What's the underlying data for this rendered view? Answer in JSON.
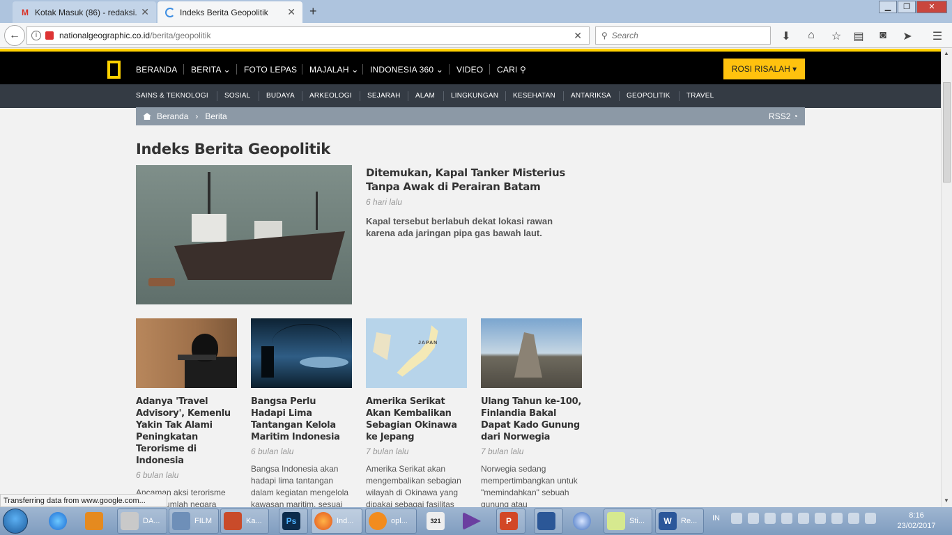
{
  "browser": {
    "tabs": [
      {
        "title": "Kotak Masuk (86) - redaksi....",
        "active": false,
        "icon": "gmail-icon"
      },
      {
        "title": "Indeks Berita Geopolitik",
        "active": true,
        "icon": "loading-icon"
      }
    ],
    "new_tab": "+",
    "url_host": "nationalgeographic.co.id",
    "url_path": "/berita/geopolitik",
    "search_placeholder": "Search",
    "status": "Transferring data from www.google.com..."
  },
  "site": {
    "brand_color": "#ffd100",
    "main_nav": [
      {
        "label": "BERANDA",
        "has_dropdown": false
      },
      {
        "label": "BERITA",
        "has_dropdown": true
      },
      {
        "label": "FOTO LEPAS",
        "has_dropdown": false
      },
      {
        "label": "MAJALAH",
        "has_dropdown": true
      },
      {
        "label": "INDONESIA 360",
        "has_dropdown": true
      },
      {
        "label": "VIDEO",
        "has_dropdown": false
      },
      {
        "label": "CARI",
        "has_dropdown": false
      }
    ],
    "user_label": "ROSI RISALAH",
    "sub_nav": [
      "SAINS & TEKNOLOGI",
      "SOSIAL",
      "BUDAYA",
      "ARKEOLOGI",
      "SEJARAH",
      "ALAM",
      "LINGKUNGAN",
      "KESEHATAN",
      "ANTARIKSA",
      "GEOPOLITIK",
      "TRAVEL"
    ],
    "breadcrumb": [
      "Beranda",
      "Berita"
    ],
    "rss_label": "RSS2"
  },
  "page": {
    "title": "Indeks Berita Geopolitik",
    "featured": {
      "title": "Ditemukan, Kapal Tanker Misterius Tanpa Awak di Perairan Batam",
      "time": "6 hari lalu",
      "excerpt": "Kapal tersebut berlabuh dekat lokasi rawan karena ada jaringan pipa gas bawah laut."
    },
    "cards": [
      {
        "title": "Adanya 'Travel Advisory', Kemenlu Yakin Tak Alami Peningkatan Terorisme di Indonesia",
        "time": "6 bulan lalu",
        "excerpt": "Ancaman aksi terorisme buat sejumlah negara"
      },
      {
        "title": "Bangsa Perlu Hadapi Lima Tantangan Kelola Maritim Indonesia",
        "time": "6 bulan lalu",
        "excerpt": "Bangsa Indonesia akan hadapi lima tantangan dalam kegiatan mengelola kawasan maritim, sesuai hukum"
      },
      {
        "title": "Amerika Serikat Akan Kembalikan Sebagian Okinawa ke Jepang",
        "time": "7 bulan lalu",
        "excerpt": "Amerika Serikat akan mengembalikan sebagian wilayah di Okinawa yang dipakai sebagai fasilitas"
      },
      {
        "title": "Ulang Tahun ke-100, Finlandia Bakal Dapat Kado Gunung dari Norwegia",
        "time": "7 bulan lalu",
        "excerpt": "Norwegia sedang mempertimbangkan untuk \"memindahkan\" sebuah gunung atau"
      }
    ],
    "map_label": "JAPAN"
  },
  "taskbar": {
    "programs": [
      {
        "label": "",
        "icon": "ie-icon"
      },
      {
        "label": "",
        "icon": "media-player-icon"
      },
      {
        "label": "DA...",
        "icon": "drive-icon"
      },
      {
        "label": "FILM",
        "icon": "folder-icon"
      },
      {
        "label": "Ka...",
        "icon": "book-icon"
      },
      {
        "label": "",
        "icon": "photoshop-icon"
      },
      {
        "label": "Ind...",
        "icon": "firefox-icon"
      },
      {
        "label": "opl...",
        "icon": "uc-browser-icon"
      },
      {
        "label": "",
        "icon": "calendar-icon"
      },
      {
        "label": "",
        "icon": "visual-studio-icon"
      },
      {
        "label": "",
        "icon": "powerpoint-icon"
      },
      {
        "label": "",
        "icon": "blue-book-icon"
      },
      {
        "label": "",
        "icon": "globe-icon"
      },
      {
        "label": "Sti...",
        "icon": "sticky-notes-icon"
      },
      {
        "label": "Re...",
        "icon": "word-icon"
      }
    ],
    "language": "IN",
    "time": "8:16",
    "date": "23/02/2017"
  }
}
